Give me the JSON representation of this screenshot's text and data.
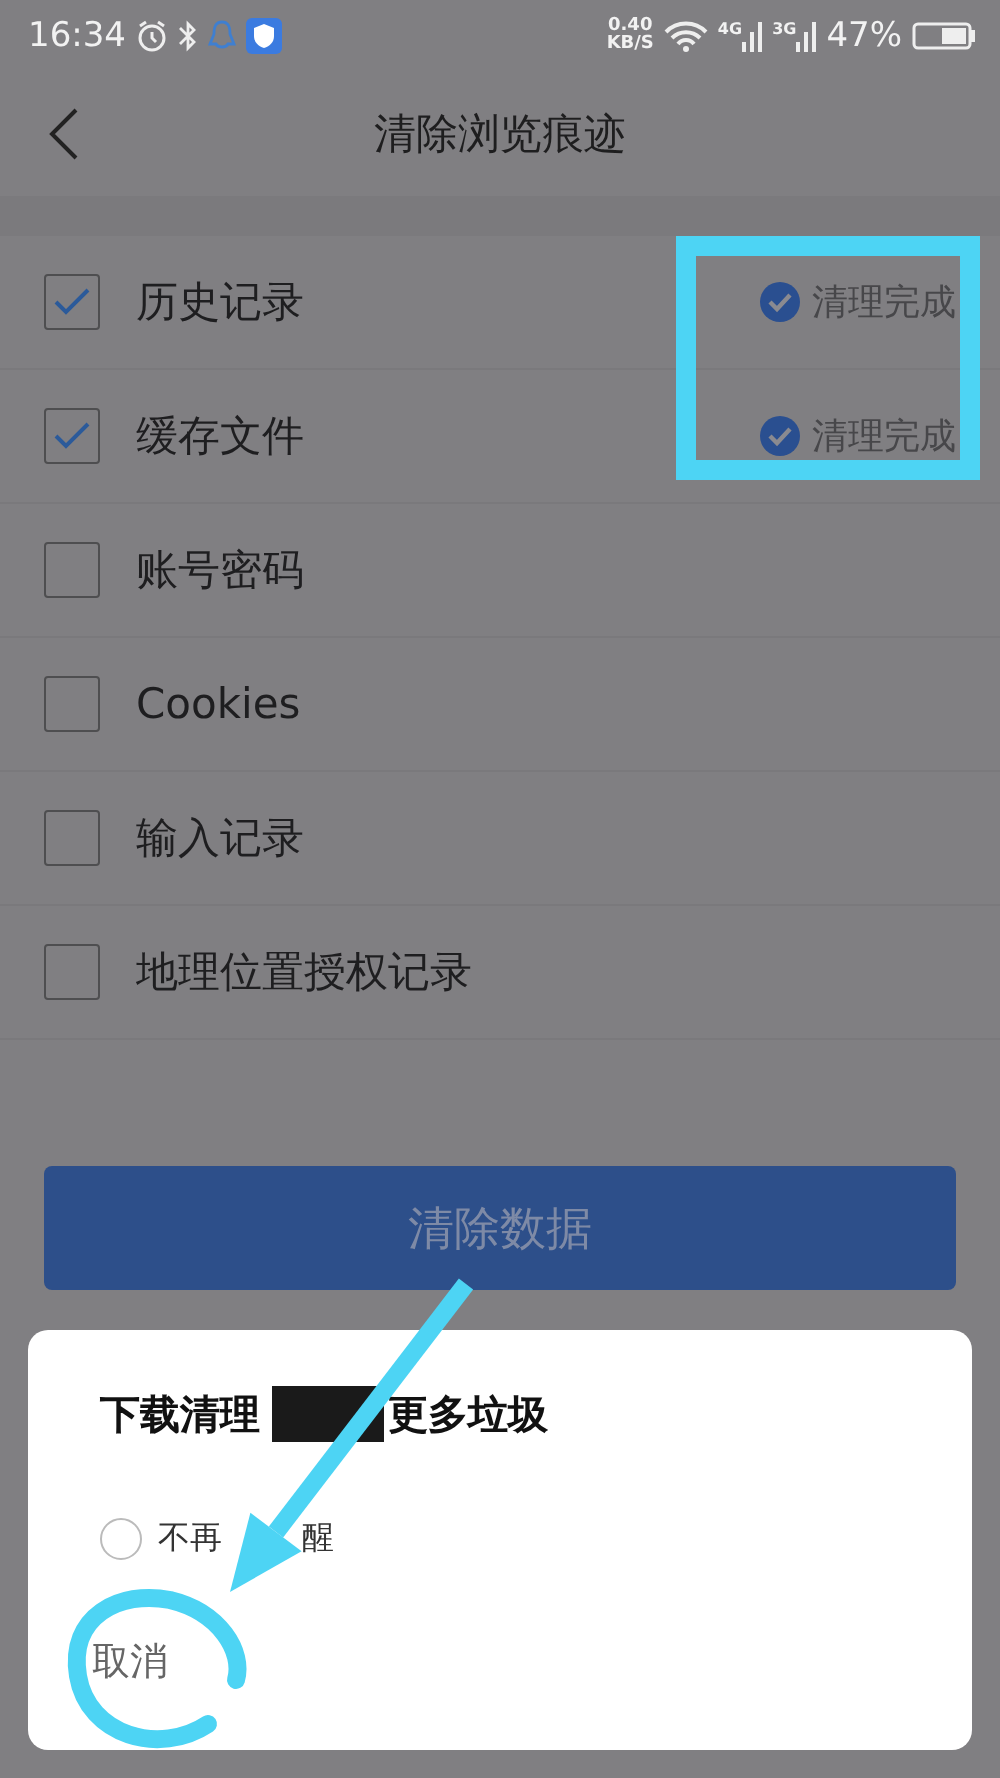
{
  "status_bar": {
    "time": "16:34",
    "speed": "0.40",
    "speed_unit": "KB/S",
    "network_1": "4G",
    "network_2": "3G",
    "battery": "47%"
  },
  "header": {
    "title": "清除浏览痕迹"
  },
  "items": [
    {
      "label": "历史记录",
      "checked": true,
      "status": "清理完成"
    },
    {
      "label": "缓存文件",
      "checked": true,
      "status": "清理完成"
    },
    {
      "label": "账号密码",
      "checked": false
    },
    {
      "label": "Cookies",
      "checked": false
    },
    {
      "label": "输入记录",
      "checked": false
    },
    {
      "label": "地理位置授权记录",
      "checked": false
    }
  ],
  "clear_button": "清除数据",
  "dialog": {
    "title_start": "下载清理",
    "title_end": "更多垃圾",
    "option": {
      "label_start": "不再",
      "label_end": "醒",
      "checked": false
    },
    "cancel": "取消"
  }
}
